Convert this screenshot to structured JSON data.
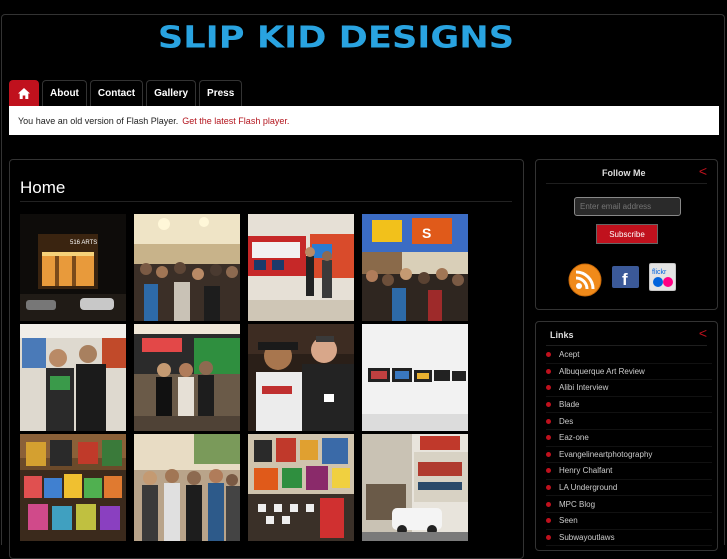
{
  "site": {
    "logo_text": "SLIP KID DESIGNS",
    "logo_color": "#29a3e0"
  },
  "nav": {
    "home_icon": "home-icon",
    "items": [
      {
        "label": "About"
      },
      {
        "label": "Contact"
      },
      {
        "label": "Gallery"
      },
      {
        "label": "Press"
      }
    ]
  },
  "notice": {
    "text": "You have an old version of Flash Player.",
    "link": "Get the latest Flash player."
  },
  "main": {
    "title": "Home",
    "gallery": [
      "photo-516-arts-storefront",
      "photo-crowd-gallery-opening",
      "photo-train-artwork-wall",
      "photo-crowd-graffiti-wall",
      "photo-two-men-portrait",
      "photo-group-graffiti-car",
      "photo-two-men-smiling",
      "photo-framed-art-row",
      "photo-art-table-display",
      "photo-group-outdoor",
      "photo-gallery-wall-art",
      "photo-art-gallery-street"
    ]
  },
  "follow": {
    "title": "Follow Me",
    "email_placeholder": "Enter email address",
    "subscribe_label": "Subscribe",
    "icons": [
      "rss-icon",
      "facebook-icon",
      "flickr-icon"
    ]
  },
  "links": {
    "title": "Links",
    "items": [
      "Acept",
      "Albuquerque Art Review",
      "Alibi Interview",
      "Blade",
      "Des",
      "Eaz-one",
      "Evangelineartphotography",
      "Henry Chalfant",
      "LA Underground",
      "MPC Blog",
      "Seen",
      "Subwayoutlaws"
    ]
  },
  "colors": {
    "accent": "#c0111d",
    "background": "#000000"
  }
}
